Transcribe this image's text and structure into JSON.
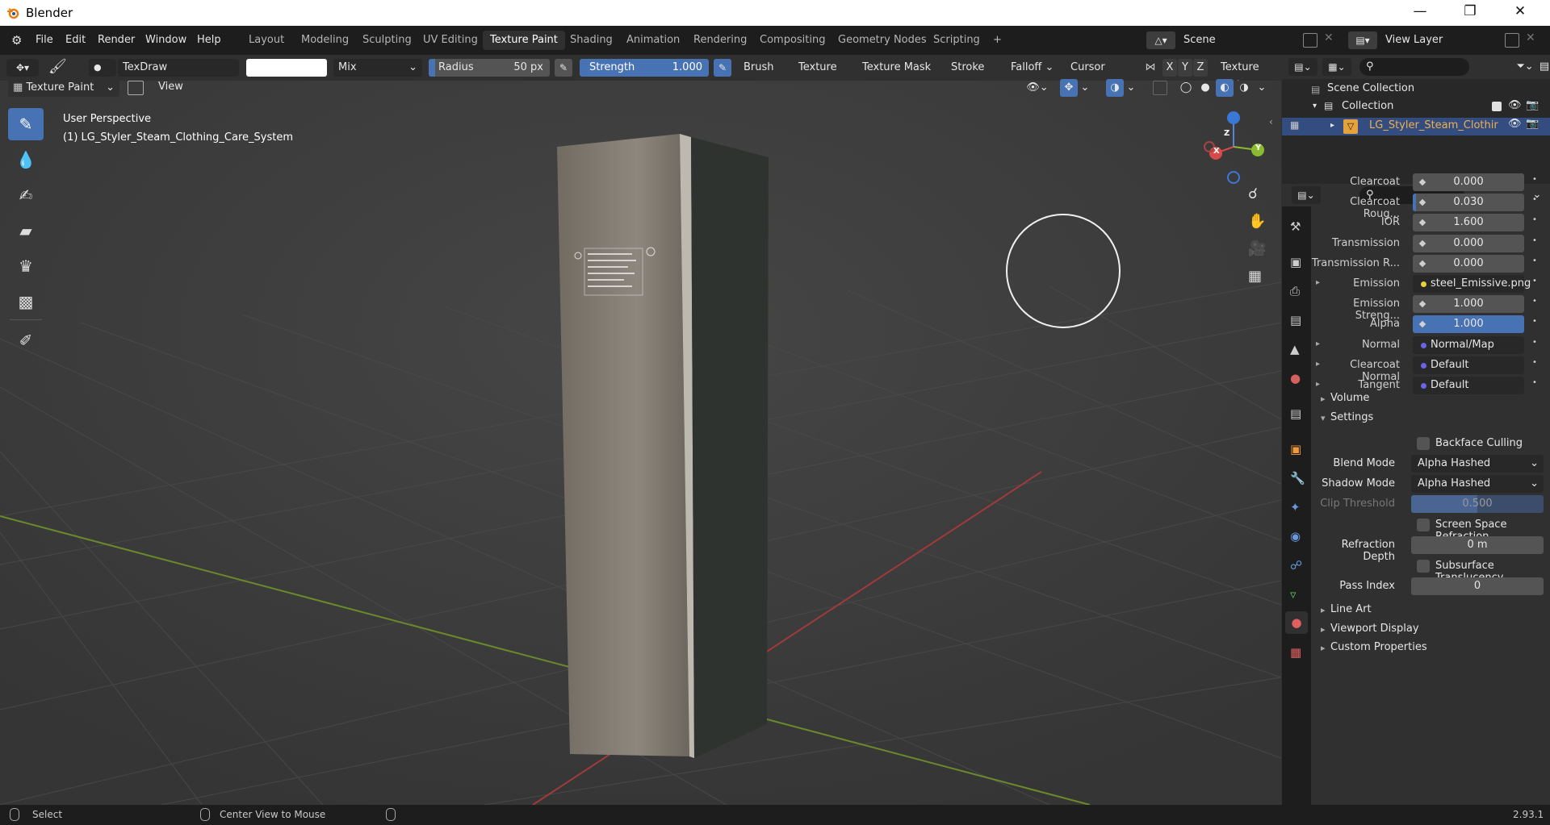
{
  "app": {
    "title": "Blender",
    "version": "2.93.1"
  },
  "menu": [
    "File",
    "Edit",
    "Render",
    "Window",
    "Help"
  ],
  "workspace_tabs": [
    "Layout",
    "Modeling",
    "Sculpting",
    "UV Editing",
    "Texture Paint",
    "Shading",
    "Animation",
    "Rendering",
    "Compositing",
    "Geometry Nodes",
    "Scripting"
  ],
  "active_tab": "Texture Paint",
  "scene": {
    "label": "Scene",
    "view_layer": "View Layer"
  },
  "toolsettings": {
    "brush_name": "TexDraw",
    "blend": "Mix",
    "radius_label": "Radius",
    "radius_value": "50 px",
    "strength_label": "Strength",
    "strength_value": "1.000",
    "strength_fraction": 1.0,
    "menus": [
      "Brush",
      "Texture",
      "Texture Mask",
      "Stroke",
      "Falloff",
      "Cursor"
    ],
    "axes": [
      "X",
      "Y",
      "Z"
    ],
    "texture_slots": "Texture Slots"
  },
  "mode": {
    "label": "Texture Paint",
    "view": "View"
  },
  "viewport": {
    "perspective": "User Perspective",
    "object": "(1) LG_Styler_Steam_Clothing_Care_System",
    "gizmo": {
      "x": "X",
      "y": "Y",
      "z": "Z"
    }
  },
  "outliner": {
    "scene_collection": "Scene Collection",
    "collection": "Collection",
    "object": "LG_Styler_Steam_Clothir"
  },
  "properties": {
    "rows": [
      {
        "label": "Clearcoat",
        "value": "0.000",
        "kind": "num"
      },
      {
        "label": "Clearcoat Roug...",
        "value": "0.030",
        "kind": "num"
      },
      {
        "label": "IOR",
        "value": "1.600",
        "kind": "num"
      },
      {
        "label": "Transmission",
        "value": "0.000",
        "kind": "num"
      },
      {
        "label": "Transmission R...",
        "value": "0.000",
        "kind": "num"
      },
      {
        "label": "Emission",
        "value": "steel_Emissive.png",
        "kind": "tex"
      },
      {
        "label": "Emission Streng...",
        "value": "1.000",
        "kind": "num"
      },
      {
        "label": "Alpha",
        "value": "1.000",
        "kind": "blue"
      },
      {
        "label": "Normal",
        "value": "Normal/Map",
        "kind": "vec"
      },
      {
        "label": "Clearcoat Normal",
        "value": "Default",
        "kind": "vec"
      },
      {
        "label": "Tangent",
        "value": "Default",
        "kind": "vec"
      }
    ],
    "volume": "Volume",
    "settings": "Settings",
    "backface_culling": "Backface Culling",
    "blend_mode_label": "Blend Mode",
    "blend_mode": "Alpha Hashed",
    "shadow_mode_label": "Shadow Mode",
    "shadow_mode": "Alpha Hashed",
    "clip_threshold_label": "Clip Threshold",
    "clip_threshold": "0.500",
    "ssr": "Screen Space Refraction",
    "refraction_depth_label": "Refraction Depth",
    "refraction_depth": "0 m",
    "subsurface": "Subsurface Translucency",
    "pass_index_label": "Pass Index",
    "pass_index": "0",
    "line_art": "Line Art",
    "viewport_display": "Viewport Display",
    "custom_properties": "Custom Properties"
  },
  "status": {
    "select": "Select",
    "center": "Center View to Mouse"
  }
}
